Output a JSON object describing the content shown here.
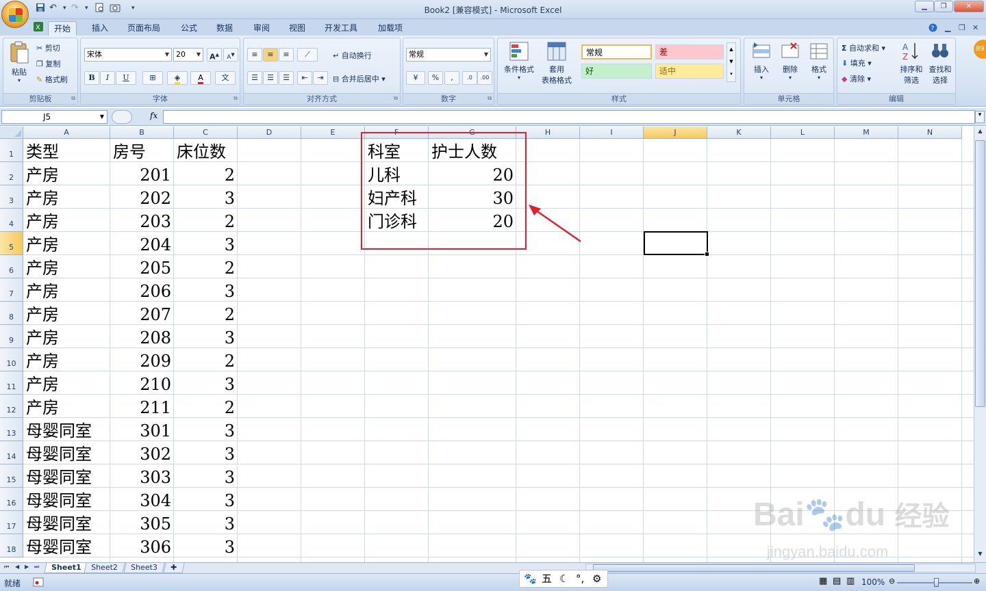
{
  "window": {
    "title": "Book2  [兼容模式] - Microsoft Excel",
    "qat_icons": [
      "save-icon",
      "undo-icon",
      "redo-icon",
      "print-preview-icon",
      "camera-icon",
      "customize-icon"
    ]
  },
  "ribbon_tabs": [
    "开始",
    "插入",
    "页面布局",
    "公式",
    "数据",
    "审阅",
    "视图",
    "开发工具",
    "加载项"
  ],
  "active_tab": "开始",
  "clipboard": {
    "paste": "粘贴",
    "cut": "剪切",
    "copy": "复制",
    "format_painter": "格式刷",
    "label": "剪贴板"
  },
  "font": {
    "name": "宋体",
    "size": "20",
    "label": "字体",
    "bold": "B",
    "italic": "I",
    "underline": "U",
    "grow": "A",
    "shrink": "A",
    "phonetic": "文"
  },
  "alignment": {
    "wrap": "自动换行",
    "merge": "合并后居中",
    "label": "对齐方式"
  },
  "number": {
    "format": "常规",
    "percent": "%",
    "comma": ",",
    "inc_decimal": ".0",
    "dec_decimal": ".00",
    "label": "数字"
  },
  "styles": {
    "cond_format": "条件格式",
    "table_format_1": "套用",
    "table_format_2": "表格格式",
    "cells": [
      "常规",
      "差",
      "好",
      "适中"
    ],
    "label": "样式"
  },
  "cells_group": {
    "insert": "插入",
    "delete": "删除",
    "format": "格式",
    "label": "单元格"
  },
  "editing": {
    "autosum": "自动求和",
    "fill": "填充",
    "clear": "清除",
    "sort_1": "排序和",
    "sort_2": "筛选",
    "find_1": "查找和",
    "find_2": "选择",
    "label": "编辑"
  },
  "formula_bar": {
    "name_box": "J5",
    "fx": "fx",
    "value": ""
  },
  "columns": [
    "A",
    "B",
    "C",
    "D",
    "E",
    "F",
    "G",
    "H",
    "I",
    "J",
    "K",
    "L",
    "M",
    "N"
  ],
  "selected_column": "J",
  "selected_row": "5",
  "rows": [
    "1",
    "2",
    "3",
    "4",
    "5",
    "6",
    "7",
    "8",
    "9",
    "10",
    "11",
    "12",
    "13",
    "14",
    "15",
    "16",
    "17",
    "18"
  ],
  "table_main": [
    [
      "类型",
      "房号",
      "床位数"
    ],
    [
      "产房",
      "201",
      "2"
    ],
    [
      "产房",
      "202",
      "3"
    ],
    [
      "产房",
      "203",
      "2"
    ],
    [
      "产房",
      "204",
      "3"
    ],
    [
      "产房",
      "205",
      "2"
    ],
    [
      "产房",
      "206",
      "3"
    ],
    [
      "产房",
      "207",
      "2"
    ],
    [
      "产房",
      "208",
      "3"
    ],
    [
      "产房",
      "209",
      "2"
    ],
    [
      "产房",
      "210",
      "3"
    ],
    [
      "产房",
      "211",
      "2"
    ],
    [
      "母婴同室",
      "301",
      "3"
    ],
    [
      "母婴同室",
      "302",
      "3"
    ],
    [
      "母婴同室",
      "303",
      "3"
    ],
    [
      "母婴同室",
      "304",
      "3"
    ],
    [
      "母婴同室",
      "305",
      "3"
    ],
    [
      "母婴同室",
      "306",
      "3"
    ]
  ],
  "table_side": [
    [
      "科室",
      "护士人数"
    ],
    [
      "儿科",
      "20"
    ],
    [
      "妇产科",
      "30"
    ],
    [
      "门诊科",
      "20"
    ]
  ],
  "sheets": [
    "Sheet1",
    "Sheet2",
    "Sheet3"
  ],
  "active_sheet": "Sheet1",
  "status": {
    "ready": "就绪",
    "zoom": "100%"
  },
  "ime": {
    "mode": "五"
  },
  "watermark": {
    "brand": "Bai",
    "brand2": "du",
    "cn": "经验",
    "url": "jingyan.baidu.com"
  },
  "colors": {
    "accent_red": "#e0202a",
    "selection": "#f7c95a"
  }
}
